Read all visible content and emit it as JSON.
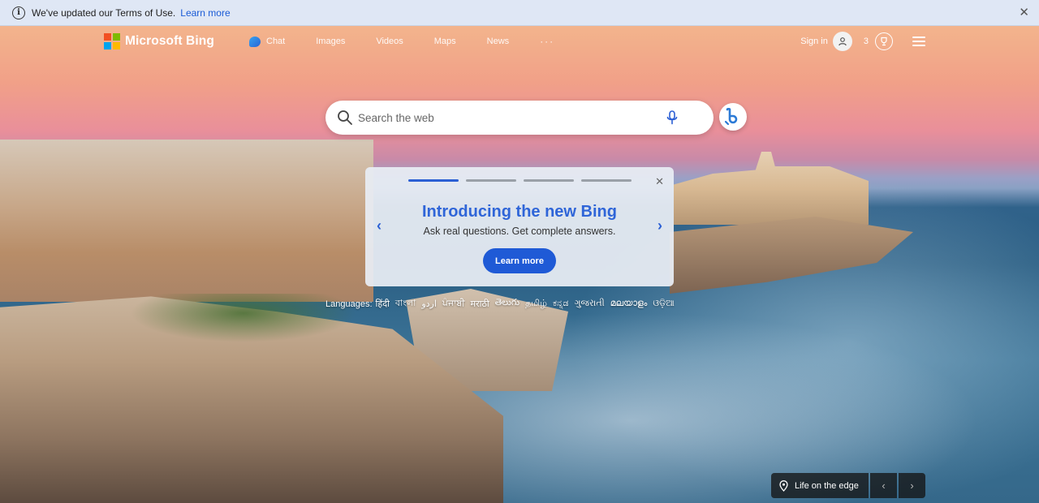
{
  "notice": {
    "message": "We've updated our Terms of Use.",
    "link": "Learn more",
    "close_glyph": "✕",
    "icon": "info-icon"
  },
  "header": {
    "brand": "Microsoft Bing",
    "nav": [
      {
        "label": "Chat",
        "icon": "chat-icon"
      },
      {
        "label": "Images"
      },
      {
        "label": "Videos"
      },
      {
        "label": "Maps"
      },
      {
        "label": "News"
      },
      {
        "label": "···"
      }
    ],
    "signin": "Sign in",
    "rewards_count": "3",
    "logo_colors": [
      "#f25022",
      "#7fba00",
      "#00a4ef",
      "#ffb900"
    ]
  },
  "search": {
    "placeholder": "Search the web"
  },
  "promo": {
    "title": "Introducing the new Bing",
    "subtitle": "Ask real questions. Get complete answers.",
    "cta": "Learn more",
    "close_glyph": "✕",
    "prev_glyph": "‹",
    "next_glyph": "›",
    "slides": 4,
    "active_slide": 1,
    "accent": "#2f65d8"
  },
  "languages": {
    "label": "Languages:",
    "items": [
      "हिंदी",
      "বাংলা",
      "اردو",
      "ਪੰਜਾਬੀ",
      "मराठी",
      "తెలుగు",
      "தமிழ்",
      "ಕನ್ನಡ",
      "ગુજરાતી",
      "മലയാളം",
      "ଓଡ଼ିଆ"
    ]
  },
  "image_info": {
    "location": "Life on the edge",
    "prev_glyph": "‹",
    "next_glyph": "›"
  }
}
